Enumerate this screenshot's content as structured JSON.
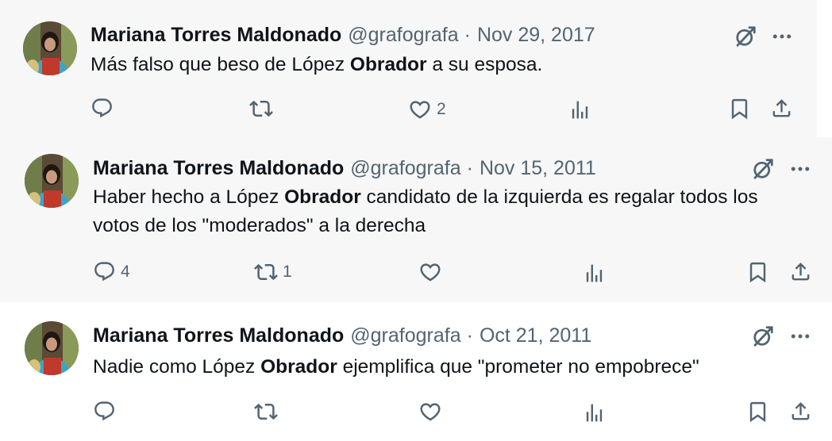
{
  "tweets": [
    {
      "author": "Mariana Torres Maldonado",
      "handle": "@grafografa",
      "separator": "·",
      "date": "Nov 29, 2017",
      "text_before": "Más falso que beso de López ",
      "text_bold": "Obrador",
      "text_after": " a su esposa.",
      "replies": "",
      "reposts": "",
      "likes": "2"
    },
    {
      "author": "Mariana Torres Maldonado",
      "handle": "@grafografa",
      "separator": "·",
      "date": "Nov 15, 2011",
      "text_before": "Haber hecho a López ",
      "text_bold": "Obrador",
      "text_after": " candidato de la izquierda es regalar todos los votos de los \"moderados\" a la derecha",
      "replies": "4",
      "reposts": "1",
      "likes": ""
    },
    {
      "author": "Mariana Torres Maldonado",
      "handle": "@grafografa",
      "separator": "·",
      "date": "Oct 21, 2011",
      "text_before": "Nadie como López ",
      "text_bold": "Obrador",
      "text_after": " ejemplifica que \"prometer no empobrece\"",
      "replies": "",
      "reposts": "",
      "likes": ""
    }
  ],
  "colors": {
    "text": "#0f1419",
    "secondary": "#536471",
    "highlight_bg": "#f7f7f7"
  },
  "icons": [
    "reply-icon",
    "repost-icon",
    "like-icon",
    "views-icon",
    "bookmark-icon",
    "share-icon",
    "grok-icon",
    "more-icon"
  ]
}
